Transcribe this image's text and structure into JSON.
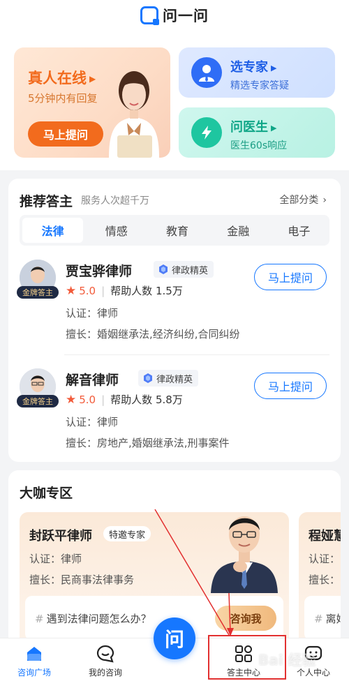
{
  "app": {
    "logo_text": "问一问"
  },
  "hero": {
    "human": {
      "title": "真人在线",
      "subtitle": "5分钟内有回复",
      "button": "马上提问"
    },
    "expert": {
      "title": "选专家",
      "subtitle": "精选专家答疑"
    },
    "doctor": {
      "title": "问医生",
      "subtitle": "医生60s响应"
    }
  },
  "recommend": {
    "title": "推荐答主",
    "subtitle": "服务人次超千万",
    "all_label": "全部分类",
    "tabs": [
      "法律",
      "情感",
      "教育",
      "金融",
      "电子"
    ],
    "active_tab": "法律",
    "lawyers": [
      {
        "name": "贾宝骅律师",
        "badge": "律政精英",
        "rank": "金牌答主",
        "score": "5.0",
        "help_label": "帮助人数",
        "help_count": "1.5万",
        "cert": "认证：律师",
        "good_at": "擅长：婚姻继承法,经济纠纷,合同纠纷",
        "button": "马上提问"
      },
      {
        "name": "解音律师",
        "badge": "律政精英",
        "rank": "金牌答主",
        "score": "5.0",
        "help_label": "帮助人数",
        "help_count": "5.8万",
        "cert": "认证：律师",
        "good_at": "擅长：房地产,婚姻继承法,刑事案件",
        "button": "马上提问"
      }
    ]
  },
  "bigshot": {
    "title": "大咖专区",
    "experts": [
      {
        "name": "封跃平律师",
        "tag": "特邀专家",
        "cert": "认证：律师",
        "good_at": "擅长：民商事法律事务",
        "ask_placeholder": "遇到法律问题怎么办？",
        "ask_button": "咨询我"
      },
      {
        "name": "程娅慧",
        "cert": "认证：",
        "good_at": "擅长：",
        "ask_placeholder": "离婚"
      }
    ]
  },
  "nav": {
    "items": [
      {
        "label": "咨询广场",
        "active": true
      },
      {
        "label": "我的咨询",
        "active": false
      },
      {
        "label": "问",
        "active": false
      },
      {
        "label": "答主中心",
        "active": false
      },
      {
        "label": "个人中心",
        "active": false
      }
    ]
  },
  "watermark": "Bai 经验",
  "colors": {
    "brand": "#1677ff",
    "orange": "#f26b1d",
    "teal": "#1ec6a0",
    "annotation": "#e23030"
  }
}
